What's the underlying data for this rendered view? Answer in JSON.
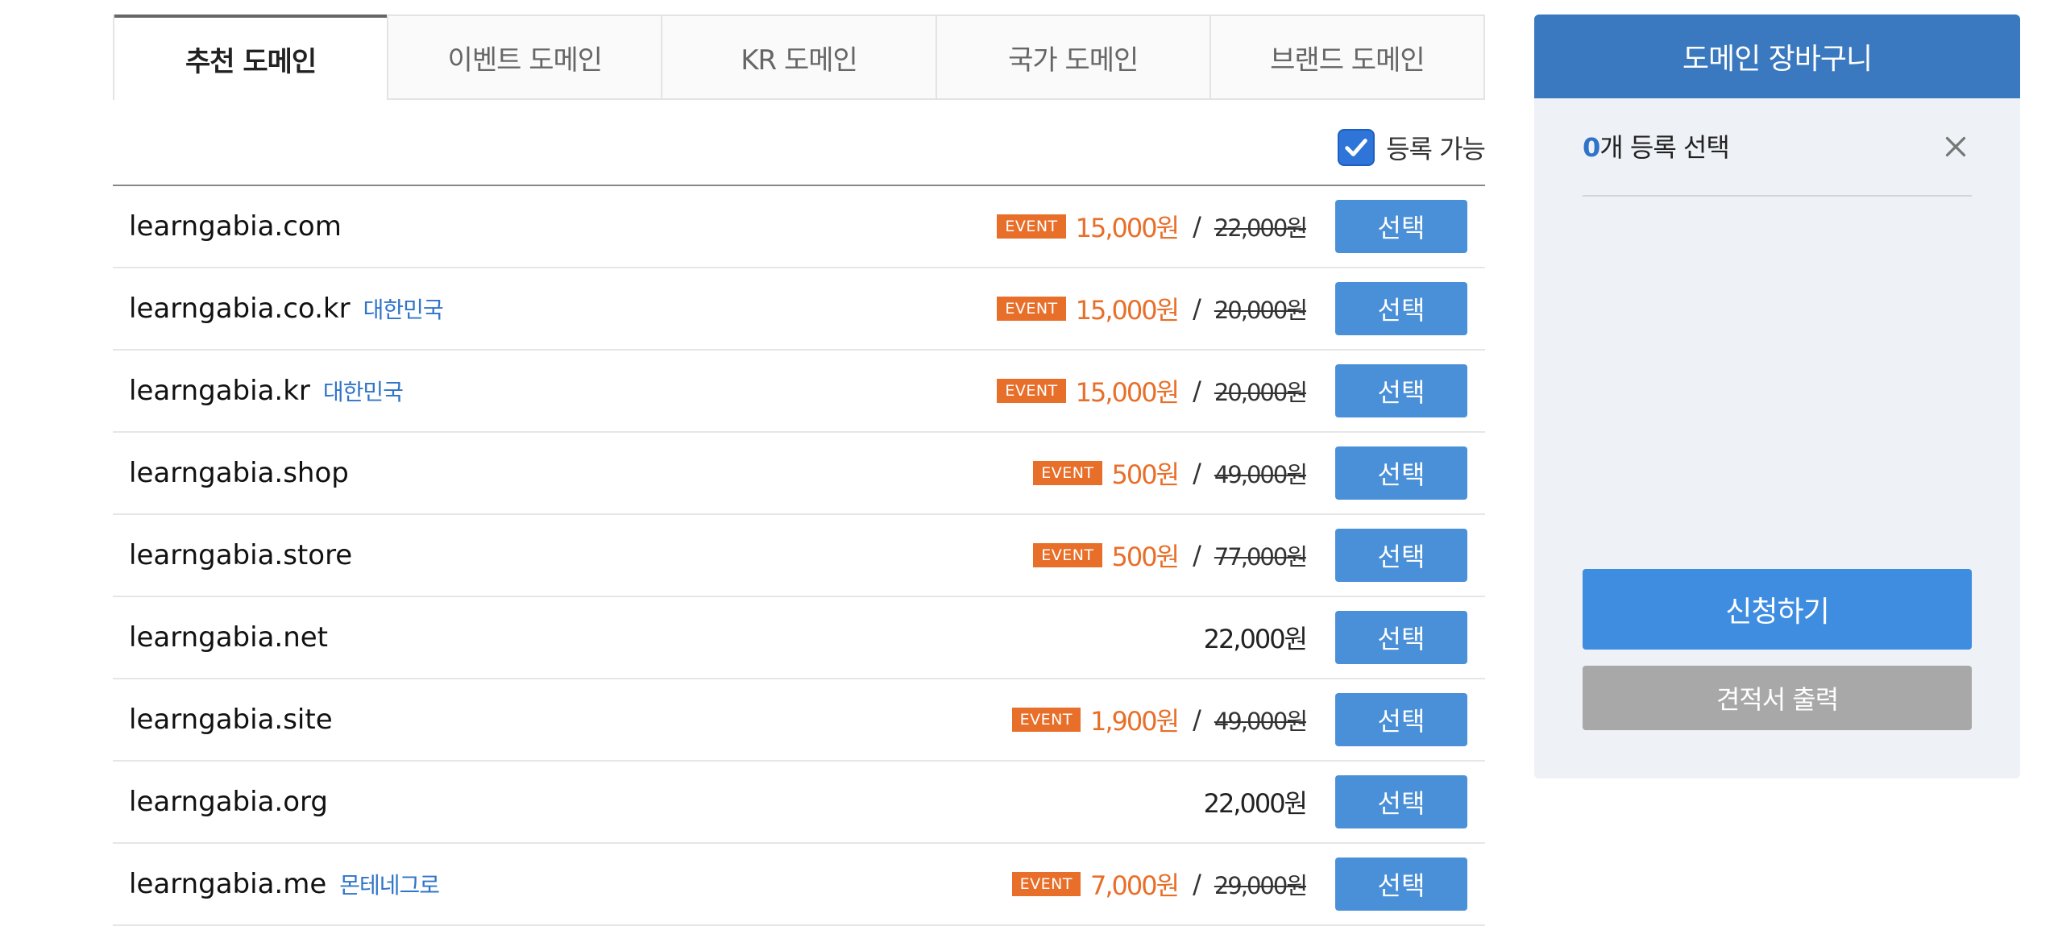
{
  "tabs": [
    {
      "label": "추천 도메인",
      "active": true
    },
    {
      "label": "이벤트 도메인",
      "active": false
    },
    {
      "label": "KR 도메인",
      "active": false
    },
    {
      "label": "국가 도메인",
      "active": false
    },
    {
      "label": "브랜드 도메인",
      "active": false
    }
  ],
  "filter": {
    "label": "등록 가능",
    "checked": true
  },
  "domains": [
    {
      "name": "learngabia.com",
      "country": "",
      "event": true,
      "badge": "EVENT",
      "price": "15,000원",
      "original": "22,000원",
      "select_label": "선택"
    },
    {
      "name": "learngabia.co.kr",
      "country": "대한민국",
      "event": true,
      "badge": "EVENT",
      "price": "15,000원",
      "original": "20,000원",
      "select_label": "선택"
    },
    {
      "name": "learngabia.kr",
      "country": "대한민국",
      "event": true,
      "badge": "EVENT",
      "price": "15,000원",
      "original": "20,000원",
      "select_label": "선택"
    },
    {
      "name": "learngabia.shop",
      "country": "",
      "event": true,
      "badge": "EVENT",
      "price": "500원",
      "original": "49,000원",
      "select_label": "선택"
    },
    {
      "name": "learngabia.store",
      "country": "",
      "event": true,
      "badge": "EVENT",
      "price": "500원",
      "original": "77,000원",
      "select_label": "선택"
    },
    {
      "name": "learngabia.net",
      "country": "",
      "event": false,
      "badge": "",
      "price": "22,000원",
      "original": "",
      "select_label": "선택"
    },
    {
      "name": "learngabia.site",
      "country": "",
      "event": true,
      "badge": "EVENT",
      "price": "1,900원",
      "original": "49,000원",
      "select_label": "선택"
    },
    {
      "name": "learngabia.org",
      "country": "",
      "event": false,
      "badge": "",
      "price": "22,000원",
      "original": "",
      "select_label": "선택"
    },
    {
      "name": "learngabia.me",
      "country": "몬테네그로",
      "event": true,
      "badge": "EVENT",
      "price": "7,000원",
      "original": "29,000원",
      "select_label": "선택"
    }
  ],
  "price_slash": "/",
  "cart": {
    "title": "도메인 장바구니",
    "count": "0",
    "count_suffix": "개 등록 선택",
    "apply_label": "신청하기",
    "quote_label": "견적서 출력"
  },
  "colors": {
    "accent": "#4a90d9",
    "cart_header": "#3a78c0",
    "event": "#e86f2a",
    "country": "#2f74c8"
  },
  "icons": {
    "close": "close-icon",
    "check": "check-icon"
  }
}
